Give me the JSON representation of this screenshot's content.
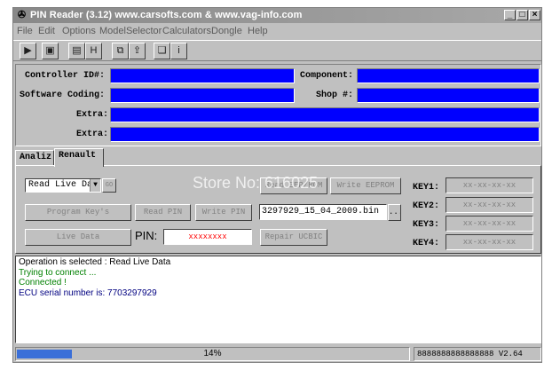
{
  "window": {
    "title": "PIN Reader (3.12) www.carsofts.com  &  www.vag-info.com",
    "controls": {
      "minimize": "_",
      "maximize": "□",
      "close": "×"
    }
  },
  "menu": [
    "File",
    "Edit",
    "Options",
    "ModelSelector",
    "Calculators",
    "Dongle",
    "Help"
  ],
  "toolbar": {
    "icons": [
      "play-icon",
      "picture-icon",
      "chip-icon",
      "hex-icon",
      "copy-icon",
      "export-icon",
      "book-icon",
      "info-icon"
    ],
    "glyphs": [
      "▶",
      "▣",
      "▤",
      "H",
      "⧉",
      "⇪",
      "❏",
      "i"
    ]
  },
  "info": {
    "controller_id_label": "Controller ID#:",
    "component_label": "Component:",
    "software_coding_label": "Software Coding:",
    "shop_label": "Shop #:",
    "extra_label_1": "Extra:",
    "extra_label_2": "Extra:",
    "field_color": "#0000ff"
  },
  "tabs": [
    "Analiz",
    "Renault"
  ],
  "renault": {
    "mode_select_value": "Read Live Dat",
    "go_button": "GO",
    "read_eep_rom": "Read EEP/ROM",
    "write_eeprom": "Write EEPROM",
    "program_keys": "Program Key's",
    "read_pin": "Read PIN",
    "write_pin": "Write PIN",
    "file_value": "3297929_15_04_2009.bin",
    "browse_button": "...",
    "live_data": "Live Data",
    "pin_label": "PIN:",
    "pin_value": "xxxxxxxx",
    "repair_ucbic": "Repair UCBIC",
    "keys": [
      {
        "label": "KEY1:",
        "value": "xx-xx-xx-xx"
      },
      {
        "label": "KEY2:",
        "value": "xx-xx-xx-xx"
      },
      {
        "label": "KEY3:",
        "value": "xx-xx-xx-xx"
      },
      {
        "label": "KEY4:",
        "value": "xx-xx-xx-xx"
      }
    ]
  },
  "log": [
    {
      "text": "Operation is selected : Read Live Data",
      "color": "#000000"
    },
    {
      "text": "Trying to connect ...",
      "color": "#008000"
    },
    {
      "text": "Connected !",
      "color": "#008000"
    },
    {
      "text": "ECU serial number is: 7703297929",
      "color": "#000080"
    }
  ],
  "status": {
    "progress_percent": 14,
    "progress_text": "14%",
    "serial_version": "8888888888888888 V2.64"
  },
  "watermark": "Store No: 616025"
}
